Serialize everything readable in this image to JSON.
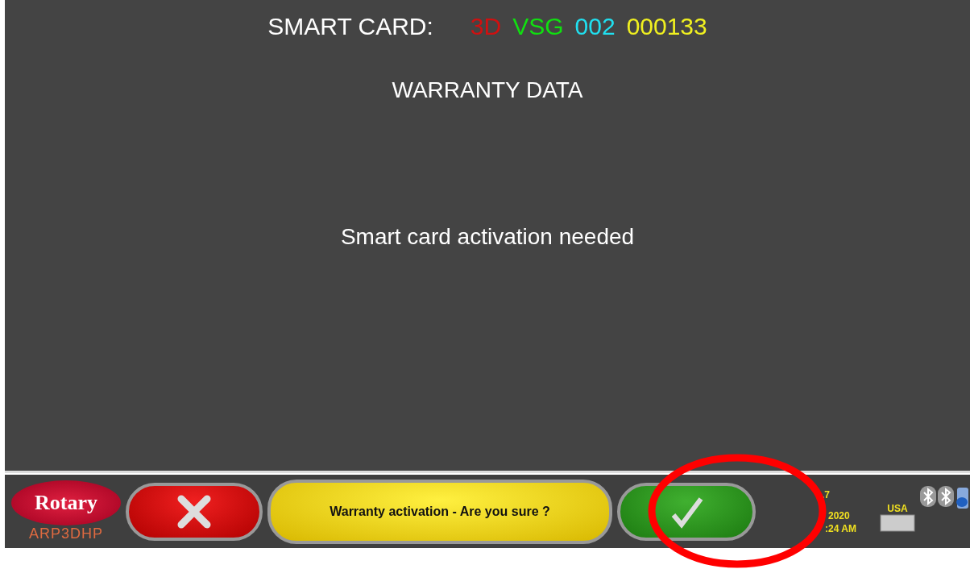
{
  "header": {
    "label": "SMART CARD:",
    "codes": [
      {
        "text": "3D",
        "color": "#d01010"
      },
      {
        "text": "VSG",
        "color": "#10e010"
      },
      {
        "text": "002",
        "color": "#20e0f0"
      },
      {
        "text": "000133",
        "color": "#f0f020"
      }
    ]
  },
  "title": "WARRANTY DATA",
  "message": "Smart card activation needed",
  "footer": {
    "logo": "Rotary",
    "model": "ARP3DHP",
    "prompt": "Warranty activation - Are you sure ?",
    "version": ".7",
    "date": "2020",
    "time": ":24 AM",
    "keyboard": "USA"
  },
  "annotation": {
    "kind": "ring",
    "color": "#ff0000"
  }
}
